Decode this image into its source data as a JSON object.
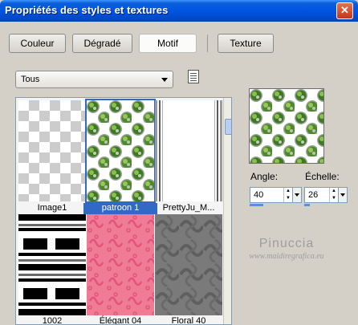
{
  "window": {
    "title": "Propriétés des styles et textures",
    "close": "✕"
  },
  "tabs": [
    {
      "label": "Couleur",
      "active": false
    },
    {
      "label": "Dégradé",
      "active": false
    },
    {
      "label": "Motif",
      "active": true
    },
    {
      "label": "Texture",
      "active": false
    }
  ],
  "category": {
    "selected": "Tous"
  },
  "gallery": {
    "items": [
      {
        "label": "Image1",
        "pattern": "transparent-checker",
        "selected": false
      },
      {
        "label": "patroon 1",
        "pattern": "grass-circles",
        "selected": true
      },
      {
        "label": "PrettyJu_M...",
        "pattern": "gray-stripes",
        "selected": false
      },
      {
        "label": "1002",
        "pattern": "black-white-bars",
        "selected": false
      },
      {
        "label": "Élégant 04",
        "pattern": "pink-swirls",
        "selected": false
      },
      {
        "label": "Floral 40",
        "pattern": "gray-floral",
        "selected": false
      }
    ]
  },
  "settings": {
    "angle_label": "Angle:",
    "angle_value": "40",
    "scale_label": "Échelle:",
    "scale_value": "26"
  },
  "watermark": {
    "name": "Pinuccia",
    "url": "www.maidiregrafica.eu"
  },
  "colors": {
    "title_bar": "#0054e3",
    "selection": "#316ac5",
    "face": "#d4d0c8"
  },
  "icons": [
    "close-icon",
    "view-options-icon",
    "dropdown-arrow-icon",
    "spin-up-icon",
    "spin-down-icon"
  ]
}
